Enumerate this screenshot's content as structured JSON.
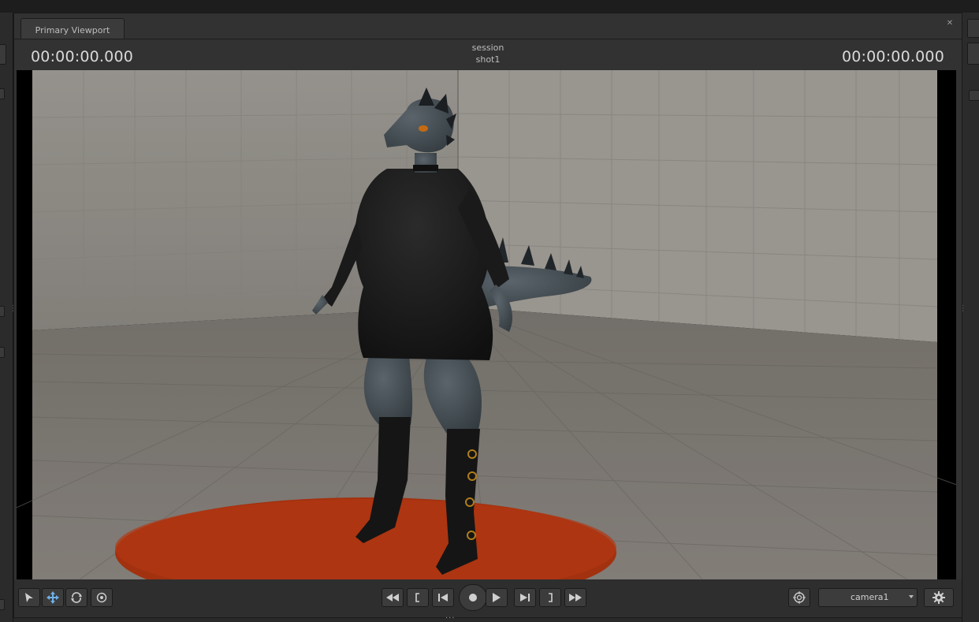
{
  "tab": {
    "label": "Primary Viewport"
  },
  "header": {
    "timecode_left": "00:00:00.000",
    "session_label": "session",
    "shot_label": "shot1",
    "timecode_right": "00:00:00.000"
  },
  "camera": {
    "selected": "camera1"
  },
  "icons": {
    "close": "close-icon",
    "select": "select-arrow-icon",
    "move": "move-icon",
    "rotate": "rotate-icon",
    "scale": "scale-icon",
    "rewind": "rewind-icon",
    "mark_in": "mark-in-icon",
    "prev": "previous-frame-icon",
    "record": "record-icon",
    "play": "play-icon",
    "next": "next-frame-icon",
    "mark_out": "mark-out-icon",
    "fastforward": "fast-forward-icon",
    "target": "target-icon",
    "settings": "gear-icon"
  },
  "colors": {
    "panel": "#323232",
    "floor": "#8a847c",
    "wall": "#9d9993",
    "platform": "#a2310f",
    "character_skin": "#3f474c",
    "dress": "#1c1c1c"
  }
}
